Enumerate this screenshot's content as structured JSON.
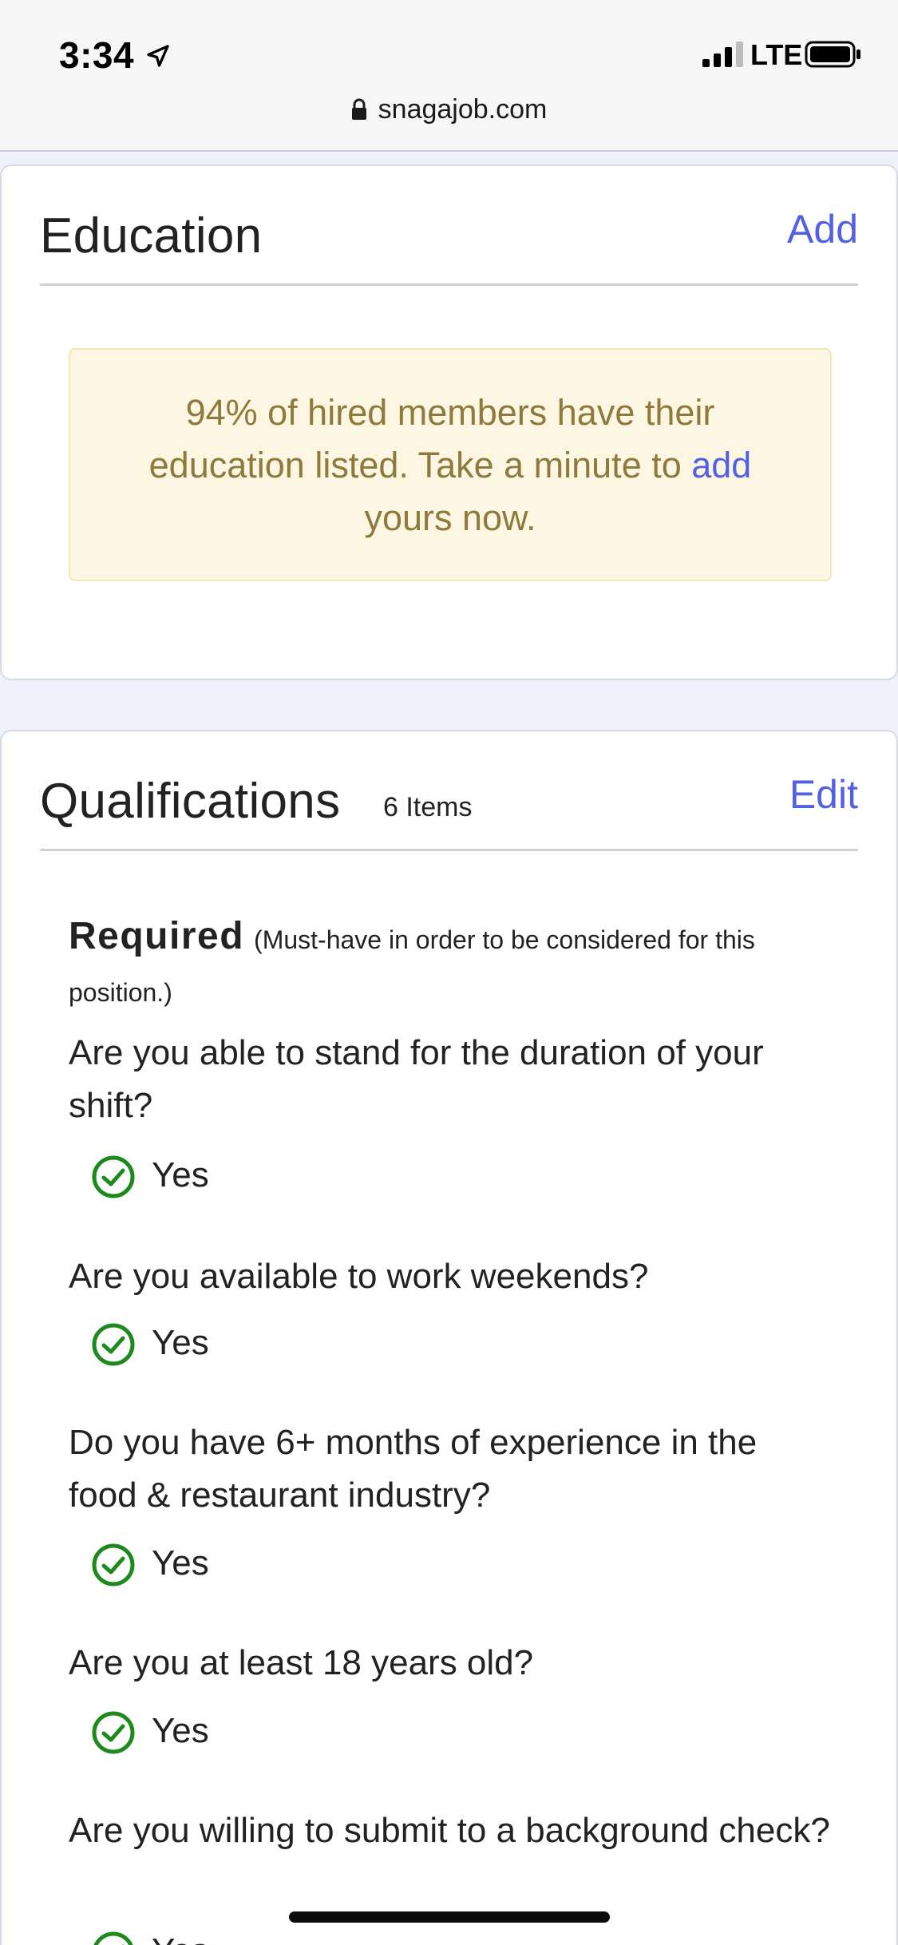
{
  "status_bar": {
    "time": "3:34",
    "network": "LTE",
    "icons": [
      "location-arrow-icon",
      "signal-bars-icon",
      "battery-icon"
    ]
  },
  "browser": {
    "url": "snagajob.com",
    "icon": "lock-icon"
  },
  "education": {
    "title": "Education",
    "action": "Add",
    "notice_text_before": "94% of hired members have their education listed. Take a minute to ",
    "notice_link": "add",
    "notice_text_after": " yours now."
  },
  "qualifications": {
    "title": "Qualifications",
    "count": "6 Items",
    "action": "Edit",
    "required_label": "Required",
    "required_note": "(Must-have in order to be considered for this position.)",
    "items": [
      {
        "question": "Are you able to stand for the duration of your shift?",
        "answer": "Yes"
      },
      {
        "question": "Are you available to work weekends?",
        "answer": "Yes"
      },
      {
        "question": "Do you have 6+ months of experience in the food & restaurant industry?",
        "answer": "Yes"
      },
      {
        "question": "Are you at least 18 years old?",
        "answer": "Yes"
      },
      {
        "question": "Are you willing to submit to a background check?",
        "answer": "Yes"
      }
    ]
  },
  "colors": {
    "accent": "#5361e0",
    "check": "#1e8a1e",
    "notice_bg": "#fdf6e2",
    "notice_text": "#8e7a3c",
    "page_bg": "#eff2fd"
  }
}
